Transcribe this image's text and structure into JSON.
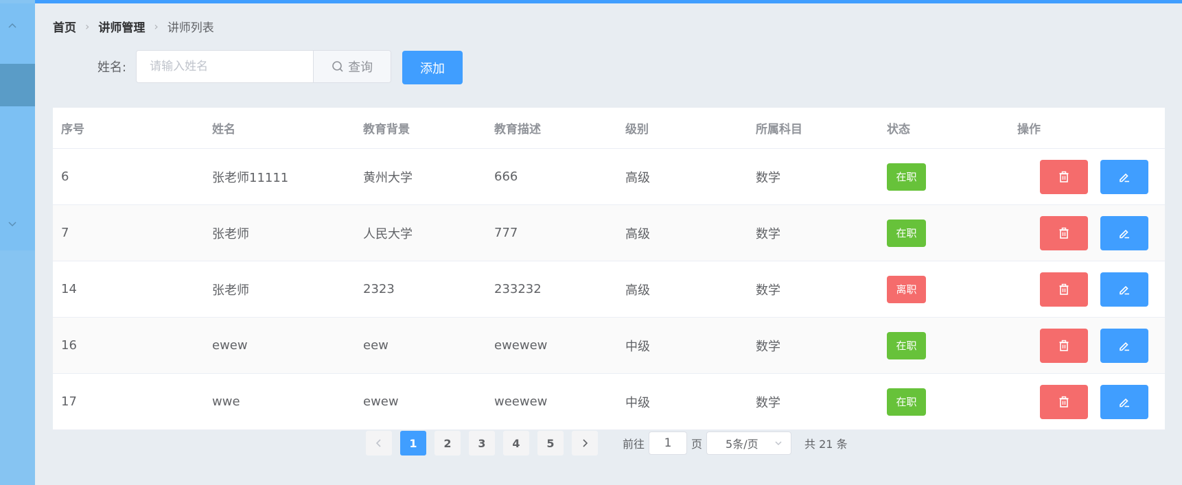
{
  "breadcrumb": {
    "home": "首页",
    "section": "讲师管理",
    "current": "讲师列表"
  },
  "search": {
    "label": "姓名:",
    "placeholder": "请输入姓名",
    "button": "查询"
  },
  "add_button": "添加",
  "table": {
    "headers": [
      "序号",
      "姓名",
      "教育背景",
      "教育描述",
      "级别",
      "所属科目",
      "状态",
      "操作"
    ],
    "rows": [
      [
        "6",
        "张老师11111",
        "黄州大学",
        "666",
        "高级",
        "数学",
        "在职"
      ],
      [
        "7",
        "张老师",
        "人民大学",
        "777",
        "高级",
        "数学",
        "在职"
      ],
      [
        "14",
        "张老师",
        "2323",
        "233232",
        "高级",
        "数学",
        "离职"
      ],
      [
        "16",
        "ewew",
        "eew",
        "ewewew",
        "中级",
        "数学",
        "在职"
      ],
      [
        "17",
        "wwe",
        "ewew",
        "weewew",
        "中级",
        "数学",
        "在职"
      ]
    ]
  },
  "status_colors": {
    "在职": "#67c23a",
    "离职": "#f56c6c"
  },
  "pagination": {
    "pages": [
      "1",
      "2",
      "3",
      "4",
      "5"
    ],
    "current": "1",
    "goto_prefix": "前往",
    "goto_value": "1",
    "goto_suffix": "页",
    "page_size": "5条/页",
    "total": "共 21 条"
  }
}
